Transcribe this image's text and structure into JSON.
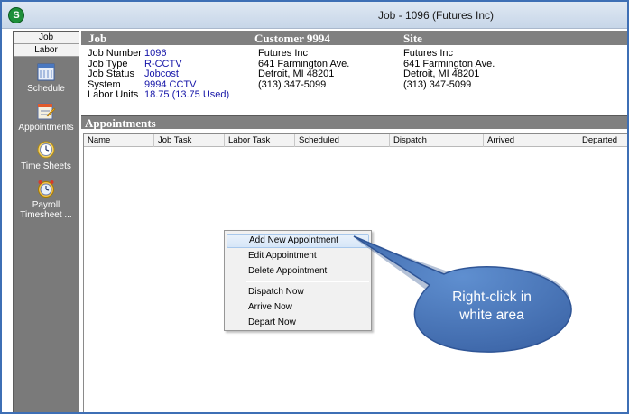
{
  "window": {
    "title": "Job - 1096 (Futures  Inc)",
    "app_icon": "S"
  },
  "leftnav": {
    "tabs": [
      "Job",
      "Labor"
    ],
    "items": [
      {
        "label": "Schedule",
        "icon": "calendar-icon"
      },
      {
        "label": "Appointments",
        "icon": "appointments-icon"
      },
      {
        "label": "Time Sheets",
        "icon": "clock-icon"
      },
      {
        "label": "Payroll",
        "label2": "Timesheet ...",
        "icon": "payroll-clock-icon"
      }
    ]
  },
  "job": {
    "heading": "Job",
    "rows": [
      {
        "label": "Job Number",
        "value": "1096"
      },
      {
        "label": "Job Type",
        "value": "R-CCTV"
      },
      {
        "label": "Job Status",
        "value": "Jobcost"
      },
      {
        "label": "System",
        "value": "9994 CCTV"
      },
      {
        "label": "Labor Units",
        "value": "18.75 (13.75 Used)"
      }
    ]
  },
  "customer": {
    "heading": "Customer 9994",
    "lines": [
      "Futures  Inc",
      "641 Farmington Ave.",
      "Detroit, MI  48201",
      "(313) 347-5099"
    ]
  },
  "site": {
    "heading": "Site",
    "lines": [
      "Futures  Inc",
      "641 Farmington Ave.",
      "Detroit, MI  48201",
      "(313) 347-5099"
    ]
  },
  "appointments": {
    "heading": "Appointments",
    "columns": [
      "Name",
      "Job Task",
      "Labor Task",
      "Scheduled",
      "Dispatch",
      "Arrived",
      "Departed"
    ]
  },
  "context_menu": {
    "items": [
      "Add New Appointment",
      "Edit Appointment",
      "Delete Appointment",
      "Dispatch Now",
      "Arrive Now",
      "Depart Now"
    ]
  },
  "callout": {
    "line1": "Right-click in",
    "line2": "white area"
  },
  "colors": {
    "accent": "#3e6fb5",
    "link": "#1515a8",
    "band": "#808080",
    "callout": "#4a74b3"
  }
}
